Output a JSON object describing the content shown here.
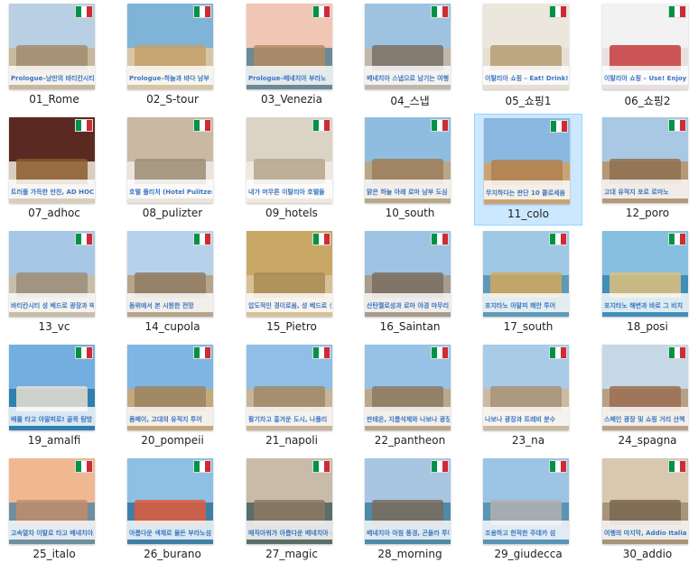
{
  "flag_colors": [
    "#009246",
    "#ffffff",
    "#ce2b37"
  ],
  "caption_color": "#3a76c4",
  "selected_index": 10,
  "folders": [
    {
      "name": "01_Rome",
      "caption": "Prologue–낭만의 바티칸시티",
      "sky": "#b9cfe3",
      "ground": "#c7b89f",
      "sil": "#a08c6e"
    },
    {
      "name": "02_S-tour",
      "caption": "Prologue–하늘과 바다 남부 투어",
      "sky": "#7fb4d8",
      "ground": "#d6c6a8",
      "sil": "#c5a06a"
    },
    {
      "name": "03_Venezia",
      "caption": "Prologue–베네치아 부라노",
      "sky": "#f0c6b4",
      "ground": "#6b8a96",
      "sil": "#b18a63"
    },
    {
      "name": "04_스냅",
      "caption": "베네치아 스냅으로 남기는 여행",
      "sky": "#9dc3e0",
      "ground": "#bfb7ac",
      "sil": "#7a7065"
    },
    {
      "name": "05_쇼핑1",
      "caption": "이탈리아 쇼핑 – Eat! Drink!",
      "sky": "#ece7dc",
      "ground": "#e6dfd2",
      "sil": "#b59d72"
    },
    {
      "name": "06_쇼핑2",
      "caption": "이탈리아 쇼핑 – Use! Enjoy!",
      "sky": "#f2f2f2",
      "ground": "#e8e0e0",
      "sil": "#c63b3b"
    },
    {
      "name": "07_adhoc",
      "caption": "트러플 가득한 만찬, AD HOC",
      "sky": "#5a2a22",
      "ground": "#d9cdbd",
      "sil": "#8a5a2e"
    },
    {
      "name": "08_pulizter",
      "caption": "호텔 풀리처 (Hotel Pulitzer)",
      "sky": "#c9b9a2",
      "ground": "#e9e4dc",
      "sil": "#9c8c74"
    },
    {
      "name": "09_hotels",
      "caption": "내가 머무른 이탈리아 호텔들",
      "sky": "#dcd3c7",
      "ground": "#efe9df",
      "sil": "#b5a48d"
    },
    {
      "name": "10_south",
      "caption": "맑은 하늘 아래 로마 남부 도심",
      "sky": "#8fbde0",
      "ground": "#b9a78a",
      "sil": "#9c7f5c"
    },
    {
      "name": "11_colo",
      "caption": "무지하다는 판단 10 콜로세움",
      "sky": "#8ab8e0",
      "ground": "#c8a474",
      "sil": "#b08050"
    },
    {
      "name": "12_poro",
      "caption": "고대 유적지 포로 로마노",
      "sky": "#a8c8e4",
      "ground": "#b49878",
      "sil": "#8e7050"
    },
    {
      "name": "13_vc",
      "caption": "바티칸시티 성 베드로 광장과 박물관",
      "sky": "#a6c8e6",
      "ground": "#c8bda8",
      "sil": "#9a8e7a"
    },
    {
      "name": "14_cupola",
      "caption": "돔위에서 본 시원한 전망",
      "sky": "#b6d2ea",
      "ground": "#b8a48a",
      "sil": "#8f7b63"
    },
    {
      "name": "15_Pietro",
      "caption": "압도적인 경이로움, 성 베드로 성당",
      "sky": "#c9a866",
      "ground": "#d6c196",
      "sil": "#a88a52"
    },
    {
      "name": "16_Saintan",
      "caption": "산탄젤로성과 로마 야경 마무리",
      "sky": "#9fc3e2",
      "ground": "#a89c8c",
      "sil": "#7a6e60"
    },
    {
      "name": "17_south",
      "caption": "포지타노 아말피 해안 투어",
      "sky": "#9ec8e4",
      "ground": "#5e9ab8",
      "sil": "#d4a85a"
    },
    {
      "name": "18_posi",
      "caption": "포지타노 해변과 바로 그 비치",
      "sky": "#86bfe0",
      "ground": "#3f8fb8",
      "sil": "#e0c07a"
    },
    {
      "name": "19_amalfi",
      "caption": "배를 타고 아말피로! 골목 탐방",
      "sky": "#72aee0",
      "ground": "#2f7fb0",
      "sil": "#e8e0d0"
    },
    {
      "name": "20_pompeii",
      "caption": "폼페이, 고대의 유적지 투어",
      "sky": "#7eb6e4",
      "ground": "#c4a87e",
      "sil": "#9c8462"
    },
    {
      "name": "21_napoli",
      "caption": "활기차고 흥겨운 도시, 나폴리",
      "sky": "#8fbfe6",
      "ground": "#c7b49a",
      "sil": "#a08866"
    },
    {
      "name": "22_pantheon",
      "caption": "판테온, 지름석제와 나보나 광장",
      "sky": "#96c2e6",
      "ground": "#bba88c",
      "sil": "#8c7a62"
    },
    {
      "name": "23_na",
      "caption": "나보나 광장과 트레비 분수",
      "sky": "#a8cbe8",
      "ground": "#cbbba0",
      "sil": "#a8927a"
    },
    {
      "name": "24_spagna",
      "caption": "스페인 광장 및 쇼핑 거리 산책",
      "sky": "#c6d8e6",
      "ground": "#b8a088",
      "sil": "#9a6e52"
    },
    {
      "name": "25_italo",
      "caption": "고속열차 이탈로 타고 베네치아로",
      "sky": "#f0b890",
      "ground": "#6f8fa0",
      "sil": "#c08c6a"
    },
    {
      "name": "26_burano",
      "caption": "아름다운 색채로 물든 부라노섬",
      "sky": "#8ec0e4",
      "ground": "#3f7fa6",
      "sil": "#e05a3a"
    },
    {
      "name": "27_magic",
      "caption": "매직아워가 아름다운 베네치아 골목",
      "sky": "#c8bca8",
      "ground": "#5a6e6a",
      "sil": "#8c7862"
    },
    {
      "name": "28_morning",
      "caption": "베네치아 아침 풍경, 곤돌라 투어",
      "sky": "#a8c6e2",
      "ground": "#4f8aa8",
      "sil": "#7a6a5a"
    },
    {
      "name": "29_giudecca",
      "caption": "조용하고 한적한 주데카 섬",
      "sky": "#9cc4e4",
      "ground": "#5a94b6",
      "sil": "#b0b0b0"
    },
    {
      "name": "30_addio",
      "caption": "여행의 마지막, Addio Italia!",
      "sky": "#d8c8b0",
      "ground": "#a89478",
      "sil": "#7a6650"
    }
  ]
}
